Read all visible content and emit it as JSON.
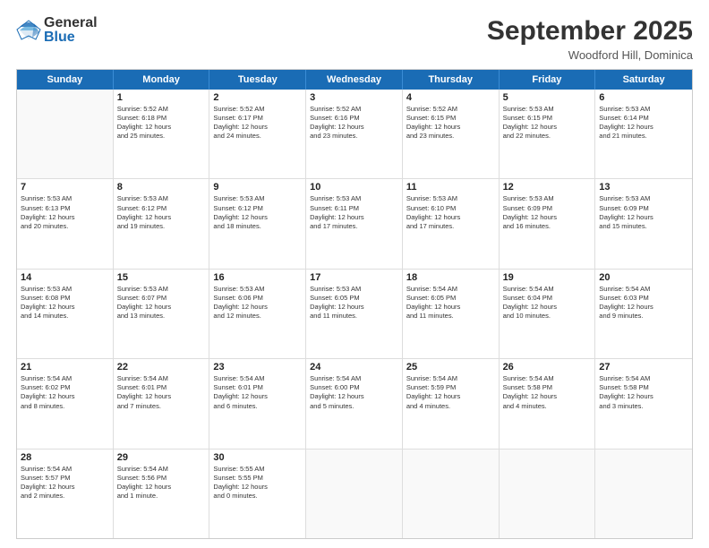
{
  "header": {
    "logo_general": "General",
    "logo_blue": "Blue",
    "month_title": "September 2025",
    "location": "Woodford Hill, Dominica"
  },
  "calendar": {
    "days_of_week": [
      "Sunday",
      "Monday",
      "Tuesday",
      "Wednesday",
      "Thursday",
      "Friday",
      "Saturday"
    ],
    "rows": [
      [
        {
          "day": "",
          "info": ""
        },
        {
          "day": "1",
          "info": "Sunrise: 5:52 AM\nSunset: 6:18 PM\nDaylight: 12 hours\nand 25 minutes."
        },
        {
          "day": "2",
          "info": "Sunrise: 5:52 AM\nSunset: 6:17 PM\nDaylight: 12 hours\nand 24 minutes."
        },
        {
          "day": "3",
          "info": "Sunrise: 5:52 AM\nSunset: 6:16 PM\nDaylight: 12 hours\nand 23 minutes."
        },
        {
          "day": "4",
          "info": "Sunrise: 5:52 AM\nSunset: 6:15 PM\nDaylight: 12 hours\nand 23 minutes."
        },
        {
          "day": "5",
          "info": "Sunrise: 5:53 AM\nSunset: 6:15 PM\nDaylight: 12 hours\nand 22 minutes."
        },
        {
          "day": "6",
          "info": "Sunrise: 5:53 AM\nSunset: 6:14 PM\nDaylight: 12 hours\nand 21 minutes."
        }
      ],
      [
        {
          "day": "7",
          "info": "Sunrise: 5:53 AM\nSunset: 6:13 PM\nDaylight: 12 hours\nand 20 minutes."
        },
        {
          "day": "8",
          "info": "Sunrise: 5:53 AM\nSunset: 6:12 PM\nDaylight: 12 hours\nand 19 minutes."
        },
        {
          "day": "9",
          "info": "Sunrise: 5:53 AM\nSunset: 6:12 PM\nDaylight: 12 hours\nand 18 minutes."
        },
        {
          "day": "10",
          "info": "Sunrise: 5:53 AM\nSunset: 6:11 PM\nDaylight: 12 hours\nand 17 minutes."
        },
        {
          "day": "11",
          "info": "Sunrise: 5:53 AM\nSunset: 6:10 PM\nDaylight: 12 hours\nand 17 minutes."
        },
        {
          "day": "12",
          "info": "Sunrise: 5:53 AM\nSunset: 6:09 PM\nDaylight: 12 hours\nand 16 minutes."
        },
        {
          "day": "13",
          "info": "Sunrise: 5:53 AM\nSunset: 6:09 PM\nDaylight: 12 hours\nand 15 minutes."
        }
      ],
      [
        {
          "day": "14",
          "info": "Sunrise: 5:53 AM\nSunset: 6:08 PM\nDaylight: 12 hours\nand 14 minutes."
        },
        {
          "day": "15",
          "info": "Sunrise: 5:53 AM\nSunset: 6:07 PM\nDaylight: 12 hours\nand 13 minutes."
        },
        {
          "day": "16",
          "info": "Sunrise: 5:53 AM\nSunset: 6:06 PM\nDaylight: 12 hours\nand 12 minutes."
        },
        {
          "day": "17",
          "info": "Sunrise: 5:53 AM\nSunset: 6:05 PM\nDaylight: 12 hours\nand 11 minutes."
        },
        {
          "day": "18",
          "info": "Sunrise: 5:54 AM\nSunset: 6:05 PM\nDaylight: 12 hours\nand 11 minutes."
        },
        {
          "day": "19",
          "info": "Sunrise: 5:54 AM\nSunset: 6:04 PM\nDaylight: 12 hours\nand 10 minutes."
        },
        {
          "day": "20",
          "info": "Sunrise: 5:54 AM\nSunset: 6:03 PM\nDaylight: 12 hours\nand 9 minutes."
        }
      ],
      [
        {
          "day": "21",
          "info": "Sunrise: 5:54 AM\nSunset: 6:02 PM\nDaylight: 12 hours\nand 8 minutes."
        },
        {
          "day": "22",
          "info": "Sunrise: 5:54 AM\nSunset: 6:01 PM\nDaylight: 12 hours\nand 7 minutes."
        },
        {
          "day": "23",
          "info": "Sunrise: 5:54 AM\nSunset: 6:01 PM\nDaylight: 12 hours\nand 6 minutes."
        },
        {
          "day": "24",
          "info": "Sunrise: 5:54 AM\nSunset: 6:00 PM\nDaylight: 12 hours\nand 5 minutes."
        },
        {
          "day": "25",
          "info": "Sunrise: 5:54 AM\nSunset: 5:59 PM\nDaylight: 12 hours\nand 4 minutes."
        },
        {
          "day": "26",
          "info": "Sunrise: 5:54 AM\nSunset: 5:58 PM\nDaylight: 12 hours\nand 4 minutes."
        },
        {
          "day": "27",
          "info": "Sunrise: 5:54 AM\nSunset: 5:58 PM\nDaylight: 12 hours\nand 3 minutes."
        }
      ],
      [
        {
          "day": "28",
          "info": "Sunrise: 5:54 AM\nSunset: 5:57 PM\nDaylight: 12 hours\nand 2 minutes."
        },
        {
          "day": "29",
          "info": "Sunrise: 5:54 AM\nSunset: 5:56 PM\nDaylight: 12 hours\nand 1 minute."
        },
        {
          "day": "30",
          "info": "Sunrise: 5:55 AM\nSunset: 5:55 PM\nDaylight: 12 hours\nand 0 minutes."
        },
        {
          "day": "",
          "info": ""
        },
        {
          "day": "",
          "info": ""
        },
        {
          "day": "",
          "info": ""
        },
        {
          "day": "",
          "info": ""
        }
      ]
    ]
  }
}
